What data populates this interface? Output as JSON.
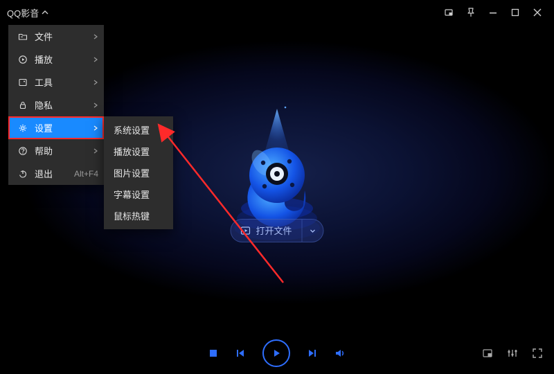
{
  "app": {
    "title": "QQ影音"
  },
  "main_menu": {
    "items": [
      {
        "label": "文件"
      },
      {
        "label": "播放"
      },
      {
        "label": "工具"
      },
      {
        "label": "隐私"
      },
      {
        "label": "设置"
      },
      {
        "label": "帮助"
      },
      {
        "label": "退出",
        "shortcut": "Alt+F4"
      }
    ],
    "selected_index": 4
  },
  "submenu": {
    "items": [
      {
        "label": "系统设置"
      },
      {
        "label": "播放设置"
      },
      {
        "label": "图片设置"
      },
      {
        "label": "字幕设置"
      },
      {
        "label": "鼠标热键"
      }
    ]
  },
  "center": {
    "open_file_label": "打开文件"
  }
}
